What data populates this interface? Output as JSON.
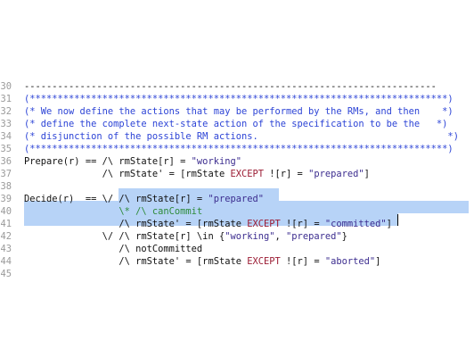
{
  "editor": {
    "lines": [
      {
        "num": "30",
        "tokens": [
          {
            "t": "--------------------------------------------------------------------------",
            "c": "t-op"
          }
        ]
      },
      {
        "num": "31",
        "tokens": [
          {
            "t": "(***************************************************************************)",
            "c": "t-cm"
          }
        ]
      },
      {
        "num": "32",
        "tokens": [
          {
            "t": "(* We now define the actions that may be performed by the RMs, and then    *)",
            "c": "t-cm"
          }
        ]
      },
      {
        "num": "33",
        "tokens": [
          {
            "t": "(* define the complete next-state action of the specification to be the   *)",
            "c": "t-cm"
          }
        ]
      },
      {
        "num": "34",
        "tokens": [
          {
            "t": "(* disjunction of the possible RM actions.                                  *)",
            "c": "t-cm"
          }
        ]
      },
      {
        "num": "35",
        "tokens": [
          {
            "t": "(***************************************************************************)",
            "c": "t-cm"
          }
        ]
      },
      {
        "num": "36",
        "tokens": [
          {
            "t": "Prepare(r) == /\\ rmState[r] = ",
            "c": "t-id"
          },
          {
            "t": "\"working\"",
            "c": "t-str"
          }
        ]
      },
      {
        "num": "37",
        "tokens": [
          {
            "t": "              /\\ rmState' = [rmState ",
            "c": "t-id"
          },
          {
            "t": "EXCEPT",
            "c": "t-kw"
          },
          {
            "t": " ![r] = ",
            "c": "t-id"
          },
          {
            "t": "\"prepared\"",
            "c": "t-str"
          },
          {
            "t": "]",
            "c": "t-id"
          }
        ]
      },
      {
        "num": "38",
        "tokens": []
      },
      {
        "num": "39",
        "tokens": [
          {
            "t": "Decide(r)  == \\/ /\\ rmState[r] = ",
            "c": "t-id"
          },
          {
            "t": "\"prepared\"",
            "c": "t-str"
          }
        ]
      },
      {
        "num": "40",
        "tokens": [
          {
            "t": "                 ",
            "c": "t-id"
          },
          {
            "t": "\\* /\\ canCommit",
            "c": "t-gc"
          }
        ]
      },
      {
        "num": "41",
        "tokens": [
          {
            "t": "                 /\\ rmState' = [rmState ",
            "c": "t-id"
          },
          {
            "t": "EXCEPT",
            "c": "t-kw"
          },
          {
            "t": " ![r] = ",
            "c": "t-id"
          },
          {
            "t": "\"committed\"",
            "c": "t-str"
          },
          {
            "t": "]",
            "c": "t-id"
          }
        ]
      },
      {
        "num": "42",
        "tokens": [
          {
            "t": "              \\/ /\\ rmState[r] \\in {",
            "c": "t-id"
          },
          {
            "t": "\"working\"",
            "c": "t-str"
          },
          {
            "t": ", ",
            "c": "t-id"
          },
          {
            "t": "\"prepared\"",
            "c": "t-str"
          },
          {
            "t": "}",
            "c": "t-id"
          }
        ]
      },
      {
        "num": "43",
        "tokens": [
          {
            "t": "                 /\\ notCommitted",
            "c": "t-id"
          }
        ]
      },
      {
        "num": "44",
        "tokens": [
          {
            "t": "                 /\\ rmState' = [rmState ",
            "c": "t-id"
          },
          {
            "t": "EXCEPT",
            "c": "t-kw"
          },
          {
            "t": " ![r] = ",
            "c": "t-id"
          },
          {
            "t": "\"aborted\"",
            "c": "t-str"
          },
          {
            "t": "]",
            "c": "t-id"
          }
        ]
      },
      {
        "num": "45",
        "tokens": []
      }
    ]
  }
}
